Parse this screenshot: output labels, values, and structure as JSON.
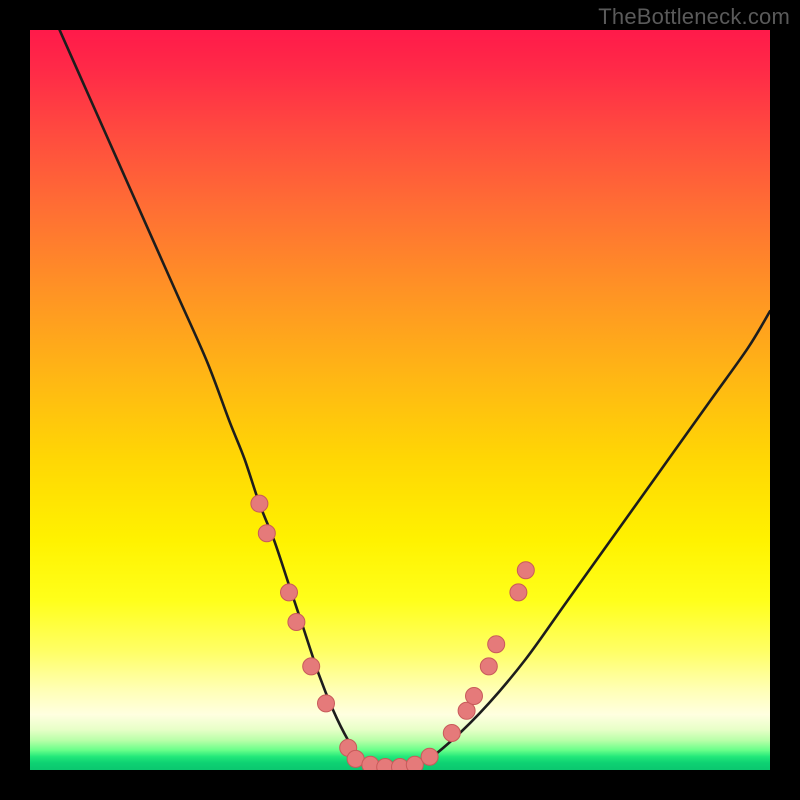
{
  "watermark": "TheBottleneck.com",
  "colors": {
    "page_bg": "#000000",
    "curve_stroke": "#1d1d1d",
    "marker_fill": "#e57a7a",
    "marker_stroke": "#c85a5a",
    "gradient_stops": [
      "#ff1a4a",
      "#ff2c47",
      "#ff4b3f",
      "#ff6e34",
      "#ff9225",
      "#ffb714",
      "#ffd704",
      "#fff200",
      "#ffff1a",
      "#ffff66",
      "#ffffb3",
      "#ffffe0",
      "#e8ffc8",
      "#b8ffa8",
      "#6aff8a",
      "#22e87a",
      "#0ed273",
      "#0bc76f"
    ]
  },
  "chart_data": {
    "type": "line",
    "title": "",
    "xlabel": "",
    "ylabel": "",
    "xlim": [
      0,
      100
    ],
    "ylim": [
      0,
      100
    ],
    "grid": false,
    "legend": false,
    "series": [
      {
        "name": "bottleneck-curve",
        "x": [
          4,
          8,
          12,
          16,
          20,
          24,
          27,
          29,
          31,
          33,
          35,
          37,
          39,
          41,
          43,
          45,
          47,
          49,
          53,
          57,
          62,
          67,
          72,
          77,
          82,
          87,
          92,
          97,
          100
        ],
        "y": [
          100,
          91,
          82,
          73,
          64,
          55,
          47,
          42,
          36,
          31,
          25,
          19,
          13,
          8,
          4,
          1,
          0,
          0,
          1,
          4,
          9,
          15,
          22,
          29,
          36,
          43,
          50,
          57,
          62
        ]
      }
    ],
    "markers": {
      "name": "highlighted-points",
      "points": [
        {
          "x": 31,
          "y": 36
        },
        {
          "x": 32,
          "y": 32
        },
        {
          "x": 35,
          "y": 24
        },
        {
          "x": 36,
          "y": 20
        },
        {
          "x": 38,
          "y": 14
        },
        {
          "x": 40,
          "y": 9
        },
        {
          "x": 43,
          "y": 3
        },
        {
          "x": 44,
          "y": 1.5
        },
        {
          "x": 46,
          "y": 0.7
        },
        {
          "x": 48,
          "y": 0.4
        },
        {
          "x": 50,
          "y": 0.4
        },
        {
          "x": 52,
          "y": 0.7
        },
        {
          "x": 54,
          "y": 1.8
        },
        {
          "x": 57,
          "y": 5
        },
        {
          "x": 59,
          "y": 8
        },
        {
          "x": 60,
          "y": 10
        },
        {
          "x": 62,
          "y": 14
        },
        {
          "x": 63,
          "y": 17
        },
        {
          "x": 66,
          "y": 24
        },
        {
          "x": 67,
          "y": 27
        }
      ]
    }
  }
}
